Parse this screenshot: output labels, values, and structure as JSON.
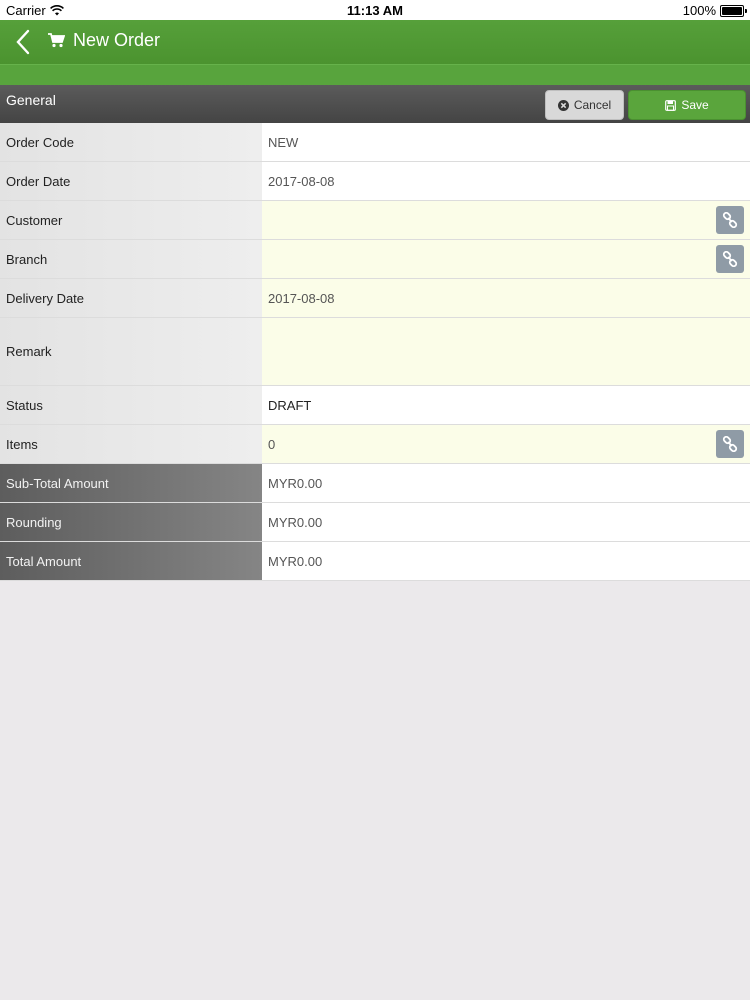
{
  "statusbar": {
    "carrier": "Carrier",
    "time": "11:13 AM",
    "battery": "100%"
  },
  "navbar": {
    "title": "New Order",
    "back_icon": "chevron-left-icon",
    "title_icon": "cart-icon"
  },
  "section": {
    "label": "General",
    "cancel_label": "Cancel",
    "save_label": "Save"
  },
  "form": {
    "order_code": {
      "label": "Order Code",
      "value": "NEW"
    },
    "order_date": {
      "label": "Order Date",
      "value": "2017-08-08"
    },
    "customer": {
      "label": "Customer",
      "value": ""
    },
    "branch": {
      "label": "Branch",
      "value": ""
    },
    "delivery_date": {
      "label": "Delivery Date",
      "value": "2017-08-08"
    },
    "remark": {
      "label": "Remark",
      "value": ""
    },
    "status": {
      "label": "Status",
      "value": "DRAFT"
    },
    "items": {
      "label": "Items",
      "value": "0"
    },
    "subtotal": {
      "label": "Sub-Total Amount",
      "value": "MYR0.00"
    },
    "rounding": {
      "label": "Rounding",
      "value": "MYR0.00"
    },
    "total": {
      "label": "Total Amount",
      "value": "MYR0.00"
    }
  },
  "colors": {
    "accent": "#56a03a",
    "header": "#4b4b4b",
    "input_bg": "#fbfde8"
  }
}
